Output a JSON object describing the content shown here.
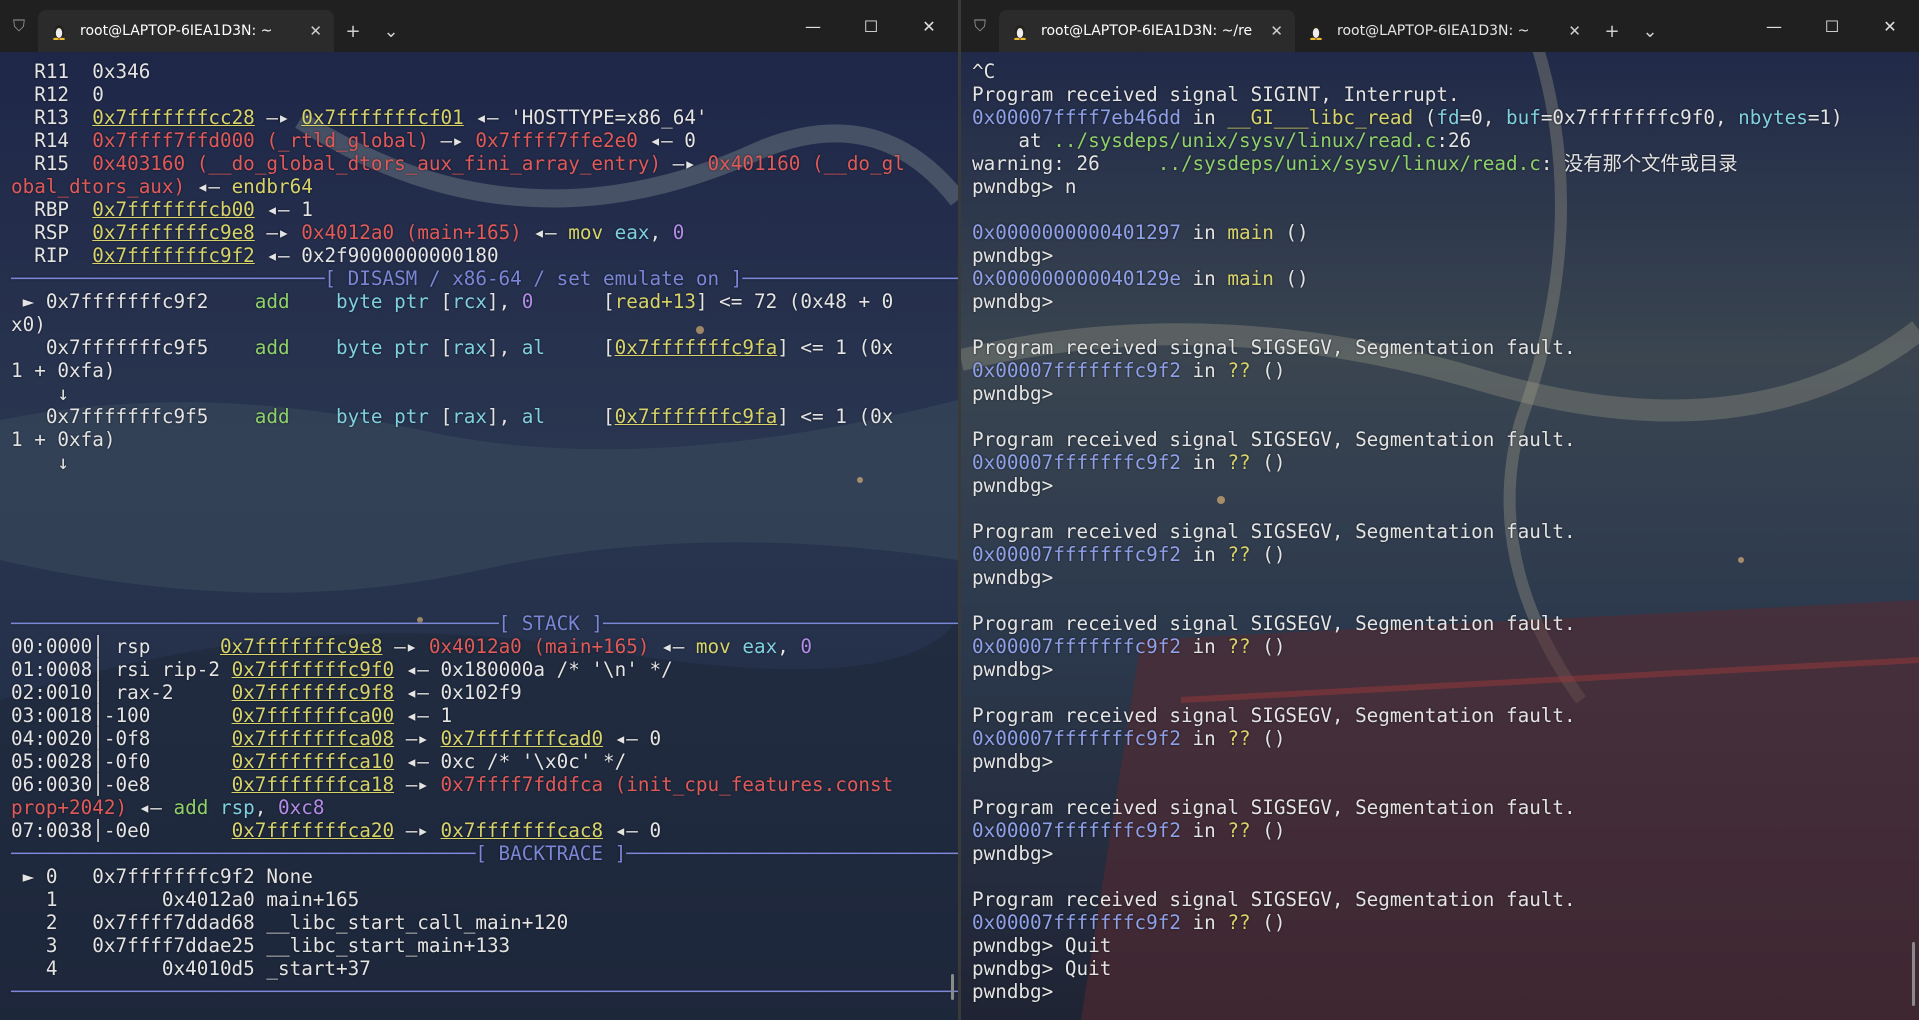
{
  "colors": {
    "fg": "#e4e4e4",
    "purple": "#b48be8",
    "yellow": "#d7d36a",
    "green": "#8fd16a",
    "cyan": "#7fd1e0",
    "red": "#e05a5a",
    "blue": "#8fa0e8",
    "sep": "#7b86d6",
    "gray": "#b0b0b0",
    "pink": "#ee90d0"
  },
  "left_window": {
    "tab": {
      "title": "root@LAPTOP-6IEA1D3N: ~"
    },
    "icons": {
      "shield": "shield-icon",
      "tux": "tux-icon",
      "close": "close-icon",
      "new_tab": "plus-icon",
      "dropdown": "chevron-down-icon",
      "minimize": "minimize-icon",
      "maximize": "maximize-icon",
      "window_close": "close-icon"
    },
    "new_tab_label": "+",
    "dropdown_label": "⌄",
    "minimize_label": "—",
    "maximize_label": "☐",
    "close_label": "✕",
    "lines": [
      [
        [
          "  R11  0x346",
          "fg"
        ]
      ],
      [
        [
          "  R12  0",
          "fg"
        ]
      ],
      [
        [
          "  R13  ",
          "fg"
        ],
        [
          "0x7fffffffcc28",
          "yellow",
          "u"
        ],
        [
          " —▸ ",
          "fg"
        ],
        [
          "0x7fffffffcf01",
          "yellow",
          "u"
        ],
        [
          " ◂— 'HOSTTYPE=x86_64'",
          "fg"
        ]
      ],
      [
        [
          "  R14  ",
          "fg"
        ],
        [
          "0x7ffff7ffd000 (_rtld_global)",
          "red"
        ],
        [
          " —▸ ",
          "fg"
        ],
        [
          "0x7ffff7ffe2e0",
          "red"
        ],
        [
          " ◂— 0",
          "fg"
        ]
      ],
      [
        [
          "  R15  ",
          "fg"
        ],
        [
          "0x403160 (__do_global_dtors_aux_fini_array_entry)",
          "red"
        ],
        [
          " —▸ ",
          "fg"
        ],
        [
          "0x401160 (__do_gl",
          "red"
        ]
      ],
      [
        [
          "obal_dtors_aux)",
          "red"
        ],
        [
          " ◂— ",
          "fg"
        ],
        [
          "endbr64",
          "yellow"
        ]
      ],
      [
        [
          "  RBP  ",
          "fg"
        ],
        [
          "0x7fffffffcb00",
          "yellow",
          "u"
        ],
        [
          " ◂— 1",
          "fg"
        ]
      ],
      [
        [
          "  RSP  ",
          "fg"
        ],
        [
          "0x7fffffffc9e8",
          "yellow",
          "u"
        ],
        [
          " —▸ ",
          "fg"
        ],
        [
          "0x4012a0 (main+165)",
          "red"
        ],
        [
          " ◂— ",
          "fg"
        ],
        [
          "mov",
          "yellow"
        ],
        [
          " ",
          "fg"
        ],
        [
          "eax",
          "cyan"
        ],
        [
          ", ",
          "fg"
        ],
        [
          "0",
          "purple"
        ]
      ],
      [
        [
          "  RIP  ",
          "fg"
        ],
        [
          "0x7fffffffc9f2",
          "yellow",
          "u"
        ],
        [
          " ◂— 0x2f9000000000180",
          "fg"
        ]
      ],
      [
        [
          "───────────────────────────[ DISASM / x86-64 / set emulate on ]──────────────────────────",
          "sep"
        ]
      ],
      [
        [
          " ► 0x7fffffffc9f2    ",
          "fg"
        ],
        [
          "add",
          "green"
        ],
        [
          "    ",
          "fg"
        ],
        [
          "byte ptr",
          "cyan"
        ],
        [
          " [",
          "fg"
        ],
        [
          "rcx",
          "cyan"
        ],
        [
          "], ",
          "fg"
        ],
        [
          "0",
          "purple"
        ],
        [
          "      [",
          "fg"
        ],
        [
          "read+13",
          "yellow"
        ],
        [
          "] <= 72 (0x48 + 0",
          "fg"
        ]
      ],
      [
        [
          "x0)",
          "fg"
        ]
      ],
      [
        [
          "   0x7fffffffc9f5    ",
          "fg"
        ],
        [
          "add",
          "green"
        ],
        [
          "    ",
          "fg"
        ],
        [
          "byte ptr",
          "cyan"
        ],
        [
          " [",
          "fg"
        ],
        [
          "rax",
          "cyan"
        ],
        [
          "], ",
          "fg"
        ],
        [
          "al",
          "cyan"
        ],
        [
          "     [",
          "fg"
        ],
        [
          "0x7fffffffc9fa",
          "yellow",
          "u"
        ],
        [
          "] <= 1 (0x",
          "fg"
        ]
      ],
      [
        [
          "1 + 0xfa)",
          "fg"
        ]
      ],
      [
        [
          "    ↓",
          "fg"
        ]
      ],
      [
        [
          "   0x7fffffffc9f5    ",
          "fg"
        ],
        [
          "add",
          "green"
        ],
        [
          "    ",
          "fg"
        ],
        [
          "byte ptr",
          "cyan"
        ],
        [
          " [",
          "fg"
        ],
        [
          "rax",
          "cyan"
        ],
        [
          "], ",
          "fg"
        ],
        [
          "al",
          "cyan"
        ],
        [
          "     [",
          "fg"
        ],
        [
          "0x7fffffffc9fa",
          "yellow",
          "u"
        ],
        [
          "] <= 1 (0x",
          "fg"
        ]
      ],
      [
        [
          "1 + 0xfa)",
          "fg"
        ]
      ],
      [
        [
          "    ↓",
          "fg"
        ]
      ],
      [
        [
          "",
          "fg"
        ]
      ],
      [
        [
          "",
          "fg"
        ]
      ],
      [
        [
          "",
          "fg"
        ]
      ],
      [
        [
          "",
          "fg"
        ]
      ],
      [
        [
          "",
          "fg"
        ]
      ],
      [
        [
          "",
          "fg"
        ]
      ],
      [
        [
          "──────────────────────────────────────────[ STACK ]─────────────────────────────────────────",
          "sep"
        ]
      ],
      [
        [
          "00:0000│ rsp      ",
          "fg"
        ],
        [
          "0x7fffffffc9e8",
          "yellow",
          "u"
        ],
        [
          " —▸ ",
          "fg"
        ],
        [
          "0x4012a0 (main+165)",
          "red"
        ],
        [
          " ◂— ",
          "fg"
        ],
        [
          "mov",
          "yellow"
        ],
        [
          " ",
          "fg"
        ],
        [
          "eax",
          "cyan"
        ],
        [
          ", ",
          "fg"
        ],
        [
          "0",
          "purple"
        ]
      ],
      [
        [
          "01:0008│ rsi rip-2 ",
          "fg"
        ],
        [
          "0x7fffffffc9f0",
          "yellow",
          "u"
        ],
        [
          " ◂— 0x180000a /* '\\n' */",
          "fg"
        ]
      ],
      [
        [
          "02:0010│ rax-2     ",
          "fg"
        ],
        [
          "0x7fffffffc9f8",
          "yellow",
          "u"
        ],
        [
          " ◂— 0x102f9",
          "fg"
        ]
      ],
      [
        [
          "03:0018│-100       ",
          "fg"
        ],
        [
          "0x7fffffffca00",
          "yellow",
          "u"
        ],
        [
          " ◂— 1",
          "fg"
        ]
      ],
      [
        [
          "04:0020│-0f8       ",
          "fg"
        ],
        [
          "0x7fffffffca08",
          "yellow",
          "u"
        ],
        [
          " —▸ ",
          "fg"
        ],
        [
          "0x7fffffffcad0",
          "yellow",
          "u"
        ],
        [
          " ◂— 0",
          "fg"
        ]
      ],
      [
        [
          "05:0028│-0f0       ",
          "fg"
        ],
        [
          "0x7fffffffca10",
          "yellow",
          "u"
        ],
        [
          " ◂— 0xc /* '\\x0c' */",
          "fg"
        ]
      ],
      [
        [
          "06:0030│-0e8       ",
          "fg"
        ],
        [
          "0x7fffffffca18",
          "yellow",
          "u"
        ],
        [
          " —▸ ",
          "fg"
        ],
        [
          "0x7ffff7fddfca (init_cpu_features.const",
          "red"
        ]
      ],
      [
        [
          "prop+2042)",
          "red"
        ],
        [
          " ◂— ",
          "fg"
        ],
        [
          "add",
          "green"
        ],
        [
          " ",
          "fg"
        ],
        [
          "rsp",
          "cyan"
        ],
        [
          ", ",
          "fg"
        ],
        [
          "0xc8",
          "purple"
        ]
      ],
      [
        [
          "07:0038│-0e0       ",
          "fg"
        ],
        [
          "0x7fffffffca20",
          "yellow",
          "u"
        ],
        [
          " —▸ ",
          "fg"
        ],
        [
          "0x7fffffffcac8",
          "yellow",
          "u"
        ],
        [
          " ◂— 0",
          "fg"
        ]
      ],
      [
        [
          "────────────────────────────────────────[ BACKTRACE ]───────────────────────────────────────",
          "sep"
        ]
      ],
      [
        [
          " ► 0   0x7fffffffc9f2 None",
          "fg"
        ]
      ],
      [
        [
          "   1         0x4012a0 main+165",
          "fg"
        ]
      ],
      [
        [
          "   2   0x7ffff7ddad68 __libc_start_call_main+120",
          "fg"
        ]
      ],
      [
        [
          "   3   0x7ffff7ddae25 __libc_start_main+133",
          "fg"
        ]
      ],
      [
        [
          "   4         0x4010d5 _start+37",
          "fg"
        ]
      ],
      [
        [
          "────────────────────────────────────────────────────────────────────────────────────────────┼",
          "sep"
        ]
      ]
    ]
  },
  "right_window": {
    "tabs": [
      {
        "title": "root@LAPTOP-6IEA1D3N: ~/re"
      },
      {
        "title": "root@LAPTOP-6IEA1D3N: ~"
      }
    ],
    "new_tab_label": "+",
    "dropdown_label": "⌄",
    "minimize_label": "—",
    "maximize_label": "☐",
    "close_label": "✕",
    "lines": [
      [
        [
          "^C",
          "fg"
        ]
      ],
      [
        [
          "Program received signal SIGINT, Interrupt.",
          "fg"
        ]
      ],
      [
        [
          "0x00007ffff7eb46dd",
          "blue"
        ],
        [
          " in ",
          "fg"
        ],
        [
          "__GI___libc_read",
          "yellow"
        ],
        [
          " (",
          "fg"
        ],
        [
          "fd",
          "cyan"
        ],
        [
          "=0, ",
          "fg"
        ],
        [
          "buf",
          "cyan"
        ],
        [
          "=0x7fffffffc9f0, ",
          "fg"
        ],
        [
          "nbytes",
          "cyan"
        ],
        [
          "=1)",
          "fg"
        ]
      ],
      [
        [
          "    at ",
          "fg"
        ],
        [
          "../sysdeps/unix/sysv/linux/read.c",
          "green"
        ],
        [
          ":26",
          "fg"
        ]
      ],
      [
        [
          "warning: 26     ",
          "fg"
        ],
        [
          "../sysdeps/unix/sysv/linux/read.c",
          "green"
        ],
        [
          ": 没有那个文件或目录",
          "fg"
        ]
      ],
      [
        [
          "pwndbg> n",
          "fg"
        ]
      ],
      [
        [
          "",
          "fg"
        ]
      ],
      [
        [
          "0x0000000000401297",
          "blue"
        ],
        [
          " in ",
          "fg"
        ],
        [
          "main",
          "yellow"
        ],
        [
          " ()",
          "fg"
        ]
      ],
      [
        [
          "pwndbg>",
          "fg"
        ]
      ],
      [
        [
          "0x000000000040129e",
          "blue"
        ],
        [
          " in ",
          "fg"
        ],
        [
          "main",
          "yellow"
        ],
        [
          " ()",
          "fg"
        ]
      ],
      [
        [
          "pwndbg>",
          "fg"
        ]
      ],
      [
        [
          "",
          "fg"
        ]
      ],
      [
        [
          "Program received signal SIGSEGV, Segmentation fault.",
          "fg"
        ]
      ],
      [
        [
          "0x00007fffffffc9f2",
          "blue"
        ],
        [
          " in ",
          "fg"
        ],
        [
          "??",
          "yellow"
        ],
        [
          " ()",
          "fg"
        ]
      ],
      [
        [
          "pwndbg>",
          "fg"
        ]
      ],
      [
        [
          "",
          "fg"
        ]
      ],
      [
        [
          "Program received signal SIGSEGV, Segmentation fault.",
          "fg"
        ]
      ],
      [
        [
          "0x00007fffffffc9f2",
          "blue"
        ],
        [
          " in ",
          "fg"
        ],
        [
          "??",
          "yellow"
        ],
        [
          " ()",
          "fg"
        ]
      ],
      [
        [
          "pwndbg>",
          "fg"
        ]
      ],
      [
        [
          "",
          "fg"
        ]
      ],
      [
        [
          "Program received signal SIGSEGV, Segmentation fault.",
          "fg"
        ]
      ],
      [
        [
          "0x00007fffffffc9f2",
          "blue"
        ],
        [
          " in ",
          "fg"
        ],
        [
          "??",
          "yellow"
        ],
        [
          " ()",
          "fg"
        ]
      ],
      [
        [
          "pwndbg>",
          "fg"
        ]
      ],
      [
        [
          "",
          "fg"
        ]
      ],
      [
        [
          "Program received signal SIGSEGV, Segmentation fault.",
          "fg"
        ]
      ],
      [
        [
          "0x00007fffffffc9f2",
          "blue"
        ],
        [
          " in ",
          "fg"
        ],
        [
          "??",
          "yellow"
        ],
        [
          " ()",
          "fg"
        ]
      ],
      [
        [
          "pwndbg>",
          "fg"
        ]
      ],
      [
        [
          "",
          "fg"
        ]
      ],
      [
        [
          "Program received signal SIGSEGV, Segmentation fault.",
          "fg"
        ]
      ],
      [
        [
          "0x00007fffffffc9f2",
          "blue"
        ],
        [
          " in ",
          "fg"
        ],
        [
          "??",
          "yellow"
        ],
        [
          " ()",
          "fg"
        ]
      ],
      [
        [
          "pwndbg>",
          "fg"
        ]
      ],
      [
        [
          "",
          "fg"
        ]
      ],
      [
        [
          "Program received signal SIGSEGV, Segmentation fault.",
          "fg"
        ]
      ],
      [
        [
          "0x00007fffffffc9f2",
          "blue"
        ],
        [
          " in ",
          "fg"
        ],
        [
          "??",
          "yellow"
        ],
        [
          " ()",
          "fg"
        ]
      ],
      [
        [
          "pwndbg>",
          "fg"
        ]
      ],
      [
        [
          "",
          "fg"
        ]
      ],
      [
        [
          "Program received signal SIGSEGV, Segmentation fault.",
          "fg"
        ]
      ],
      [
        [
          "0x00007fffffffc9f2",
          "blue"
        ],
        [
          " in ",
          "fg"
        ],
        [
          "??",
          "yellow"
        ],
        [
          " ()",
          "fg"
        ]
      ],
      [
        [
          "pwndbg> Quit",
          "fg"
        ]
      ],
      [
        [
          "pwndbg> Quit",
          "fg"
        ]
      ],
      [
        [
          "pwndbg> ",
          "fg"
        ]
      ]
    ]
  }
}
